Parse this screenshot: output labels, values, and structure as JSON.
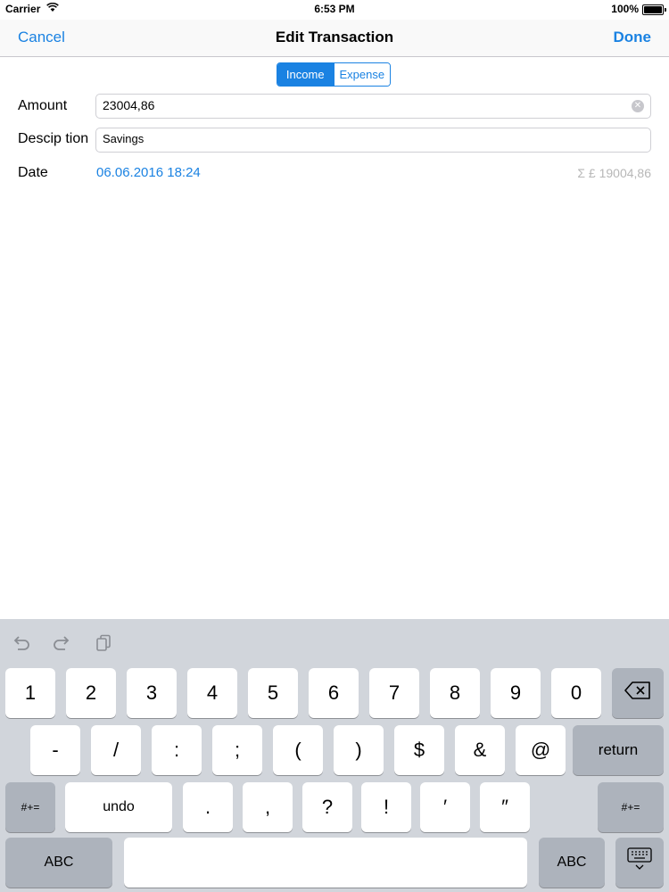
{
  "status_bar": {
    "carrier": "Carrier",
    "time": "6:53 PM",
    "battery": "100%"
  },
  "nav": {
    "cancel": "Cancel",
    "title": "Edit Transaction",
    "done": "Done"
  },
  "segments": [
    {
      "label": "Income",
      "selected": true
    },
    {
      "label": "Expense",
      "selected": false
    }
  ],
  "form": {
    "amount_label": "Amount",
    "amount_value": "23004,86",
    "description_label": "Descip tion",
    "description_value": "Savings",
    "date_label": "Date",
    "date_value": "06.06.2016 18:24",
    "total": "Σ £ 19004,86"
  },
  "keyboard": {
    "toolbar_icons": [
      "undo-arrow-icon",
      "redo-arrow-icon",
      "paste-icon"
    ],
    "row1": [
      "1",
      "2",
      "3",
      "4",
      "5",
      "6",
      "7",
      "8",
      "9",
      "0"
    ],
    "row2": [
      "-",
      "/",
      ":",
      ";",
      "(",
      ")",
      "$",
      "&",
      "@"
    ],
    "row3": [
      ".",
      ",",
      "?",
      "!",
      "′",
      "″"
    ],
    "return": "return",
    "symbols": "#+=",
    "undo": "undo",
    "abc": "ABC",
    "icons": {
      "delete": "delete-icon",
      "dismiss": "keyboard-dismiss-icon"
    }
  },
  "colors": {
    "accent": "#1a82e2",
    "keyboard_bg": "#d1d5db",
    "secondary_text": "#b7b7b7"
  }
}
